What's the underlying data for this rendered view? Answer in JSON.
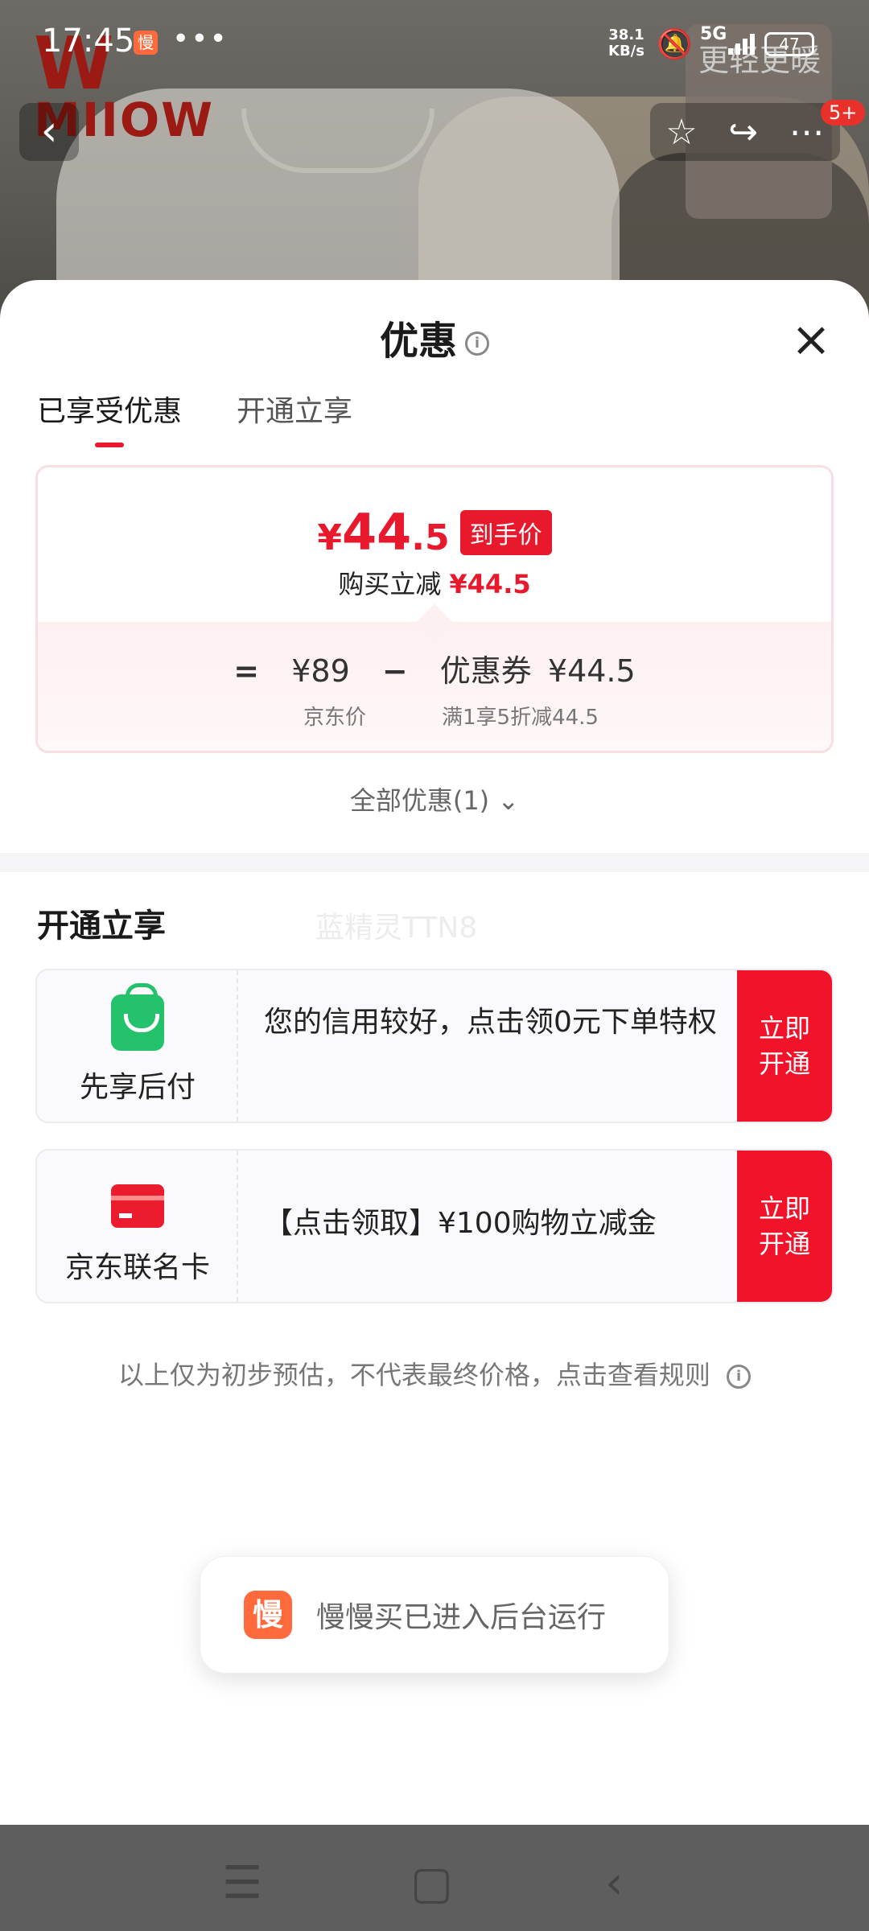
{
  "status_bar": {
    "time": "17:45",
    "app_badge": "慢",
    "menu_dots": "•••",
    "net_speed_value": "38.1",
    "net_speed_unit": "KB/s",
    "network": "5G",
    "battery": "47"
  },
  "hero": {
    "brand_logo_text": "MIIOW",
    "ad_text": "更轻更暖",
    "badge_count": "5+"
  },
  "sheet": {
    "title": "优惠",
    "close_label": "×",
    "tabs": [
      {
        "label": "已享受优惠",
        "active": true
      },
      {
        "label": "开通立享",
        "active": false
      }
    ],
    "price_card": {
      "currency": "¥",
      "final_price_int": "44",
      "final_price_dec": ".5",
      "final_tag": "到手价",
      "reduce_label": "购买立减",
      "reduce_value": "¥44.5",
      "equals": "=",
      "jd_price": "¥89",
      "minus": "−",
      "coupon_label": "优惠券",
      "coupon_value": "¥44.5",
      "jd_price_caption": "京东价",
      "coupon_caption": "满1享5折减44.5"
    },
    "all_offers": "全部优惠(1)",
    "section_title": "开通立享",
    "watermark": "蓝精灵TTN8",
    "offers": [
      {
        "icon": "shopping-bag-icon",
        "label": "先享后付",
        "desc": "您的信用较好，点击领0元下单特权",
        "action": "立即开通"
      },
      {
        "icon": "credit-card-icon",
        "label": "京东联名卡",
        "desc": "【点击领取】¥100购物立减金",
        "action": "立即开通"
      }
    ],
    "disclaimer": "以上仅为初步预估，不代表最终价格，点击查看规则"
  },
  "toast": {
    "icon_text": "慢",
    "text": "慢慢买已进入后台运行"
  },
  "colors": {
    "accent_red": "#e8192c",
    "action_red": "#f0132a",
    "green": "#23c26b"
  }
}
